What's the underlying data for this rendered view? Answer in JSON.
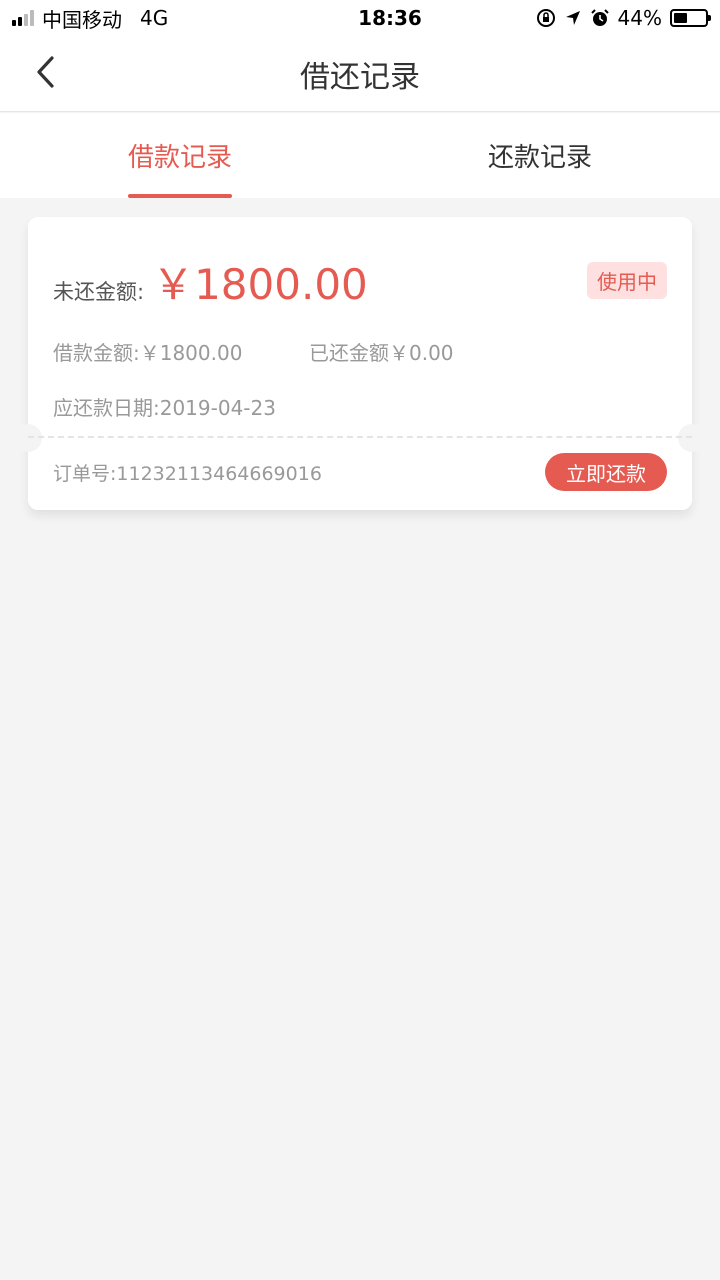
{
  "status_bar": {
    "carrier": "中国移动",
    "network": "4G",
    "time": "18:36",
    "battery": "44%",
    "battery_level": 0.44
  },
  "nav": {
    "title": "借还记录"
  },
  "tabs": [
    {
      "label": "借款记录",
      "active": true
    },
    {
      "label": "还款记录",
      "active": false
    }
  ],
  "record": {
    "outstanding_label": "未还金额:",
    "outstanding_amount": "￥1800.00",
    "status": "使用中",
    "loan_amount": "借款金额:￥1800.00",
    "repaid_amount": "已还金额￥0.00",
    "due_date": "应还款日期:2019-04-23",
    "order_no": "订单号:11232113464669016",
    "repay_button": "立即还款"
  },
  "colors": {
    "accent": "#e55b52",
    "badge_bg": "#fde0df",
    "page_bg": "#f4f4f4"
  }
}
